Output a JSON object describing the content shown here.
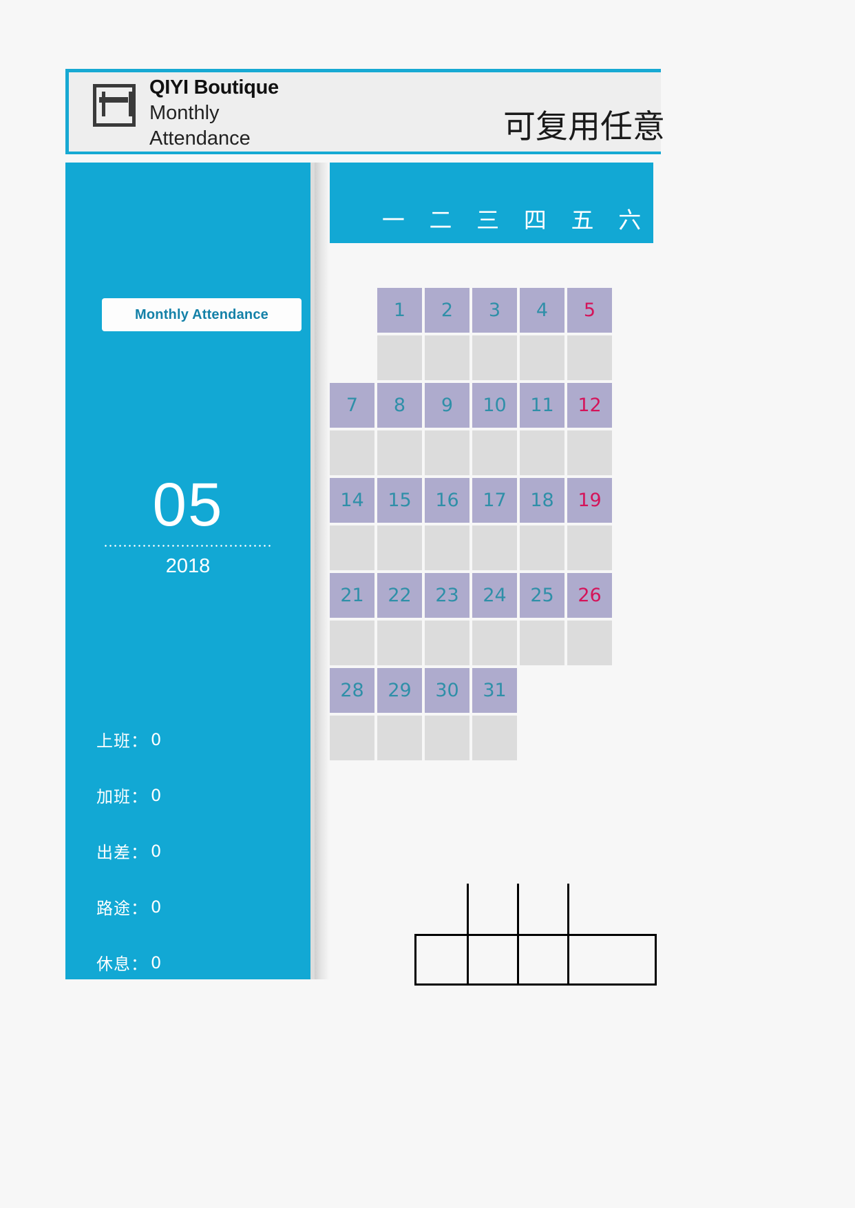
{
  "header": {
    "logo_icon": "calendar-book-icon",
    "brand_title": "QIYI Boutique",
    "brand_subtitle_line1": "Monthly",
    "brand_subtitle_line2": "Attendance",
    "note_text": "可复用任意",
    "accent_color": "#17a9d3"
  },
  "sidebar": {
    "button_label": "Monthly Attendance",
    "month": "05",
    "year": "2018",
    "background_color": "#12a8d4",
    "stats": [
      {
        "label": "上班：",
        "value": "0"
      },
      {
        "label": "加班：",
        "value": "0"
      },
      {
        "label": "出差：",
        "value": "0"
      },
      {
        "label": "路途：",
        "value": "0"
      },
      {
        "label": "休息：",
        "value": "0"
      }
    ]
  },
  "calendar": {
    "weekdays": [
      "一",
      "二",
      "三",
      "四",
      "五",
      "六"
    ],
    "header_background": "#12a8d4",
    "day_cell_color": "#aeabcd",
    "note_cell_color": "#dcdcdc",
    "weekday_number_color": "#2f8fa8",
    "saturday_number_color": "#d4145a",
    "weeks": [
      {
        "days": [
          "",
          "1",
          "2",
          "3",
          "4",
          "5"
        ]
      },
      {
        "days": [
          "7",
          "8",
          "9",
          "10",
          "11",
          "12"
        ]
      },
      {
        "days": [
          "14",
          "15",
          "16",
          "17",
          "18",
          "19"
        ]
      },
      {
        "days": [
          "21",
          "22",
          "23",
          "24",
          "25",
          "26"
        ]
      },
      {
        "days": [
          "28",
          "29",
          "30",
          "31",
          "",
          ""
        ]
      }
    ]
  }
}
